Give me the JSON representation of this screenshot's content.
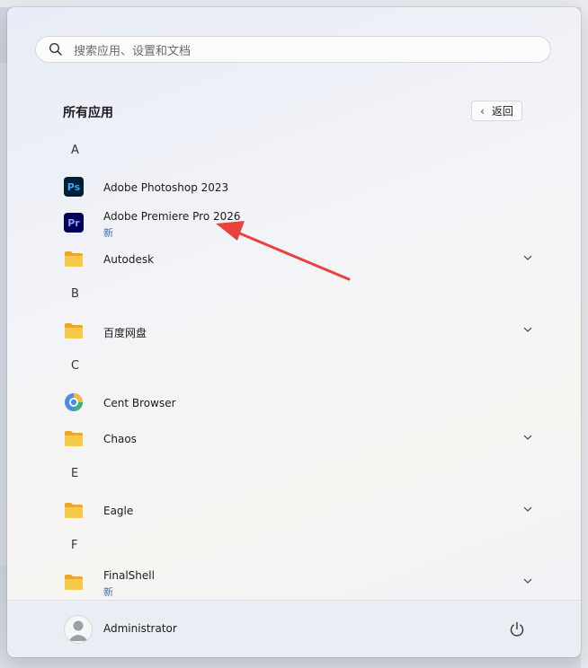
{
  "search": {
    "placeholder": "搜索应用、设置和文档"
  },
  "section": {
    "title": "所有应用",
    "back_label": "返回"
  },
  "letters": {
    "a": "A",
    "b": "B",
    "c": "C",
    "e": "E",
    "f": "F"
  },
  "apps": {
    "photoshop": {
      "name": "Adobe Photoshop 2023",
      "icon_text": "Ps"
    },
    "premiere": {
      "name": "Adobe Premiere Pro 2026",
      "icon_text": "Pr",
      "badge": "新"
    },
    "autodesk": {
      "name": "Autodesk"
    },
    "baidu": {
      "name": "百度网盘"
    },
    "cent": {
      "name": "Cent Browser"
    },
    "chaos": {
      "name": "Chaos"
    },
    "eagle": {
      "name": "Eagle"
    },
    "finalshell": {
      "name": "FinalShell",
      "badge": "新"
    }
  },
  "footer": {
    "user": "Administrator"
  },
  "colors": {
    "accent": "#3b6fb6",
    "arrow": "#e8423f",
    "folder": "#f5c242"
  }
}
